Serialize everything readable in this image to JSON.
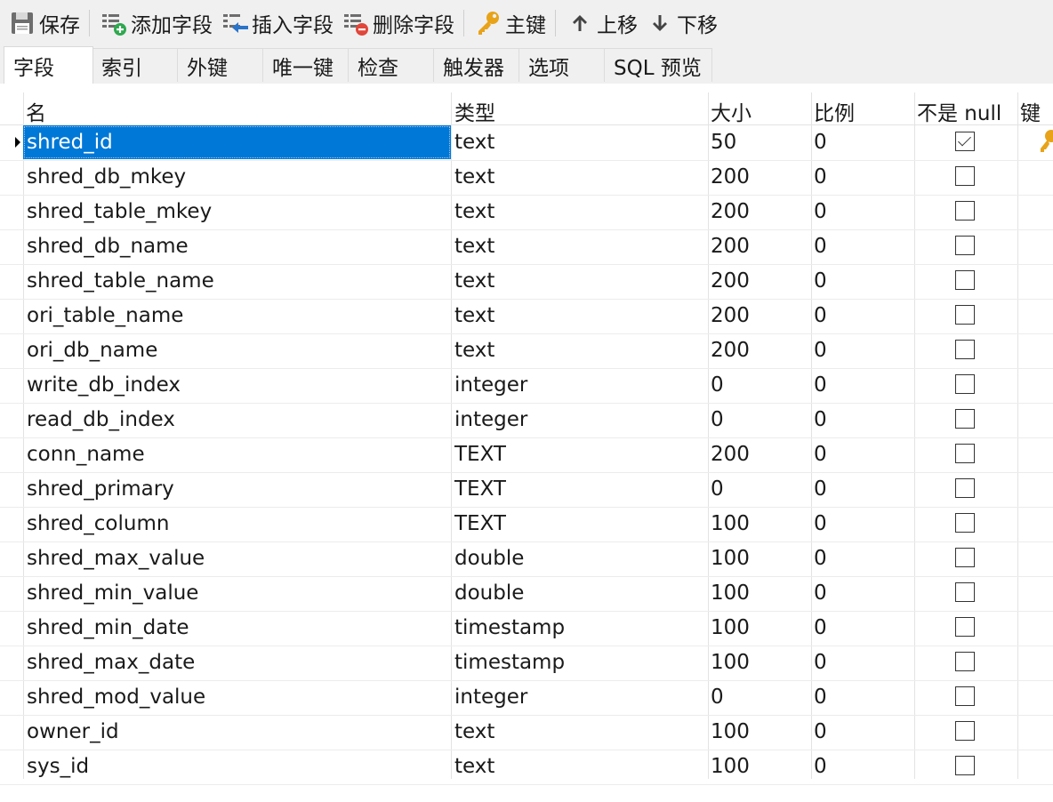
{
  "toolbar": {
    "save": "保存",
    "add_field": "添加字段",
    "insert_field": "插入字段",
    "delete_field": "删除字段",
    "primary_key": "主键",
    "move_up": "上移",
    "move_down": "下移"
  },
  "tabs": [
    "字段",
    "索引",
    "外键",
    "唯一键",
    "检查",
    "触发器",
    "选项",
    "SQL 预览"
  ],
  "active_tab": "字段",
  "columns": {
    "name": "名",
    "type": "类型",
    "size": "大小",
    "scale": "比例",
    "not_null": "不是 null",
    "key": "键"
  },
  "rows": [
    {
      "name": "shred_id",
      "type": "text",
      "size": "50",
      "scale": "0",
      "not_null": true,
      "key": true,
      "selected": true
    },
    {
      "name": "shred_db_mkey",
      "type": "text",
      "size": "200",
      "scale": "0",
      "not_null": false
    },
    {
      "name": "shred_table_mkey",
      "type": "text",
      "size": "200",
      "scale": "0",
      "not_null": false
    },
    {
      "name": "shred_db_name",
      "type": "text",
      "size": "200",
      "scale": "0",
      "not_null": false
    },
    {
      "name": "shred_table_name",
      "type": "text",
      "size": "200",
      "scale": "0",
      "not_null": false
    },
    {
      "name": "ori_table_name",
      "type": "text",
      "size": "200",
      "scale": "0",
      "not_null": false
    },
    {
      "name": "ori_db_name",
      "type": "text",
      "size": "200",
      "scale": "0",
      "not_null": false
    },
    {
      "name": "write_db_index",
      "type": "integer",
      "size": "0",
      "scale": "0",
      "not_null": false
    },
    {
      "name": "read_db_index",
      "type": "integer",
      "size": "0",
      "scale": "0",
      "not_null": false
    },
    {
      "name": "conn_name",
      "type": "TEXT",
      "size": "200",
      "scale": "0",
      "not_null": false
    },
    {
      "name": "shred_primary",
      "type": "TEXT",
      "size": "0",
      "scale": "0",
      "not_null": false
    },
    {
      "name": "shred_column",
      "type": "TEXT",
      "size": "100",
      "scale": "0",
      "not_null": false
    },
    {
      "name": "shred_max_value",
      "type": "double",
      "size": "100",
      "scale": "0",
      "not_null": false
    },
    {
      "name": "shred_min_value",
      "type": "double",
      "size": "100",
      "scale": "0",
      "not_null": false
    },
    {
      "name": "shred_min_date",
      "type": "timestamp",
      "size": "100",
      "scale": "0",
      "not_null": false
    },
    {
      "name": "shred_max_date",
      "type": "timestamp",
      "size": "100",
      "scale": "0",
      "not_null": false
    },
    {
      "name": "shred_mod_value",
      "type": "integer",
      "size": "0",
      "scale": "0",
      "not_null": false
    },
    {
      "name": "owner_id",
      "type": "text",
      "size": "100",
      "scale": "0",
      "not_null": false
    },
    {
      "name": "sys_id",
      "type": "text",
      "size": "100",
      "scale": "0",
      "not_null": false
    }
  ],
  "colors": {
    "selection": "#0078d7",
    "toolbar_bg": "#f0f0f0",
    "key_icon": "#e8a318",
    "add_icon": "#2fa84f",
    "delete_icon": "#e0463a",
    "insert_icon": "#2a74c9"
  }
}
